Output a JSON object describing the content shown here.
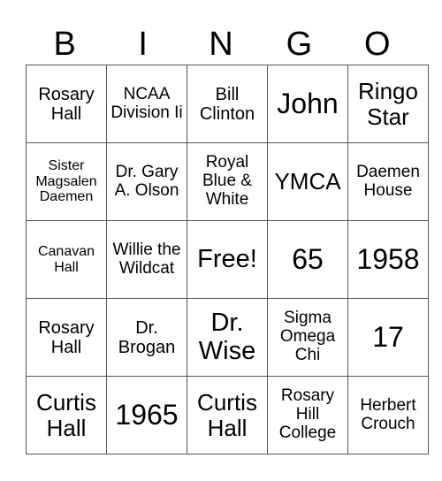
{
  "header": [
    "B",
    "I",
    "N",
    "G",
    "O"
  ],
  "rows": [
    [
      "Rosary Hall",
      "NCAA Division Ii",
      "Bill Clinton",
      "John",
      "Ringo Star"
    ],
    [
      "Sister Magsalen Daemen",
      "Dr. Gary A. Olson",
      "Royal Blue & White",
      "YMCA",
      "Daemen House"
    ],
    [
      "Canavan Hall",
      "Willie the Wildcat",
      "Free!",
      "65",
      "1958"
    ],
    [
      "Rosary Hall",
      "Dr. Brogan",
      "Dr. Wise",
      "Sigma Omega Chi",
      "17"
    ],
    [
      "Curtis Hall",
      "1965",
      "Curtis Hall",
      "Rosary Hill College",
      "Herbert Crouch"
    ]
  ]
}
